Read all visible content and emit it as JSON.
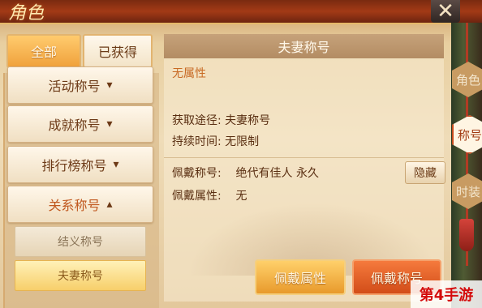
{
  "window": {
    "title": "角色",
    "close_label": "✕"
  },
  "tabs": {
    "all": "全部",
    "obtained": "已获得"
  },
  "categories": [
    {
      "label": "活动称号"
    },
    {
      "label": "成就称号"
    },
    {
      "label": "排行榜称号"
    },
    {
      "label": "关系称号"
    }
  ],
  "subcategories": [
    {
      "label": "结义称号"
    },
    {
      "label": "夫妻称号"
    }
  ],
  "detail": {
    "header": "夫妻称号",
    "attribute": "无属性",
    "source": "获取途径: 夫妻称号",
    "duration": "持续时间: 无限制",
    "worn_title": "佩戴称号:    绝代有佳人 永久",
    "worn_attribute": "佩戴属性:    无",
    "hide_button": "隐藏",
    "wear_attribute_button": "佩戴属性",
    "wear_title_button": "佩戴称号"
  },
  "side_tabs": [
    {
      "label": "角色"
    },
    {
      "label": "称号"
    },
    {
      "label": "时装"
    }
  ],
  "watermark": "第4手游"
}
